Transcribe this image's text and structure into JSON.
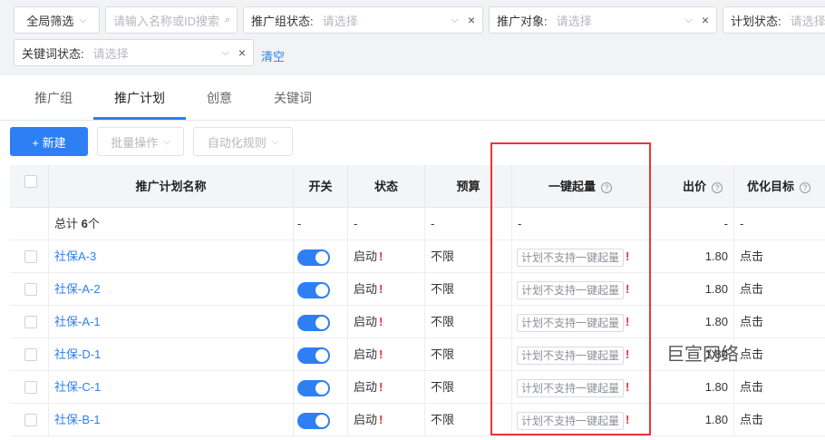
{
  "filters": {
    "global_filter": "全局筛选",
    "search_placeholder": "请输入名称或ID搜索",
    "group_status_label": "推广组状态:",
    "object_label": "推广对象:",
    "plan_status_label": "计划状态:",
    "keyword_status_label": "关键词状态:",
    "select_placeholder": "请选择",
    "clear": "清空"
  },
  "tabs": [
    {
      "label": "推广组"
    },
    {
      "label": "推广计划"
    },
    {
      "label": "创意"
    },
    {
      "label": "关键词"
    }
  ],
  "toolbar": {
    "new_label": "+ 新建",
    "batch_label": "批量操作",
    "auto_rule_label": "自动化规则"
  },
  "table": {
    "headers": {
      "name": "推广计划名称",
      "switch": "开关",
      "status": "状态",
      "budget": "预算",
      "boost": "一键起量",
      "bid": "出价",
      "target": "优化目标"
    },
    "summary": {
      "total_prefix": "总计 ",
      "total_count": "6",
      "total_suffix": "个",
      "dash": "-"
    },
    "rows": [
      {
        "name": "社保A-3",
        "status": "启动",
        "budget": "不限",
        "boost": "计划不支持一键起量",
        "bid": "1.80",
        "target": "点击"
      },
      {
        "name": "社保-A-2",
        "status": "启动",
        "budget": "不限",
        "boost": "计划不支持一键起量",
        "bid": "1.80",
        "target": "点击"
      },
      {
        "name": "社保-A-1",
        "status": "启动",
        "budget": "不限",
        "boost": "计划不支持一键起量",
        "bid": "1.80",
        "target": "点击"
      },
      {
        "name": "社保-D-1",
        "status": "启动",
        "budget": "不限",
        "boost": "计划不支持一键起量",
        "bid": "1.80",
        "target": "点击"
      },
      {
        "name": "社保-C-1",
        "status": "启动",
        "budget": "不限",
        "boost": "计划不支持一键起量",
        "bid": "1.80",
        "target": "点击"
      },
      {
        "name": "社保-B-1",
        "status": "启动",
        "budget": "不限",
        "boost": "计划不支持一键起量",
        "bid": "1.80",
        "target": "点击"
      }
    ]
  },
  "watermark": "巨宣网络",
  "colors": {
    "accent": "#2d7ff3",
    "highlight": "#e8353a",
    "warning": "#e6313d"
  }
}
